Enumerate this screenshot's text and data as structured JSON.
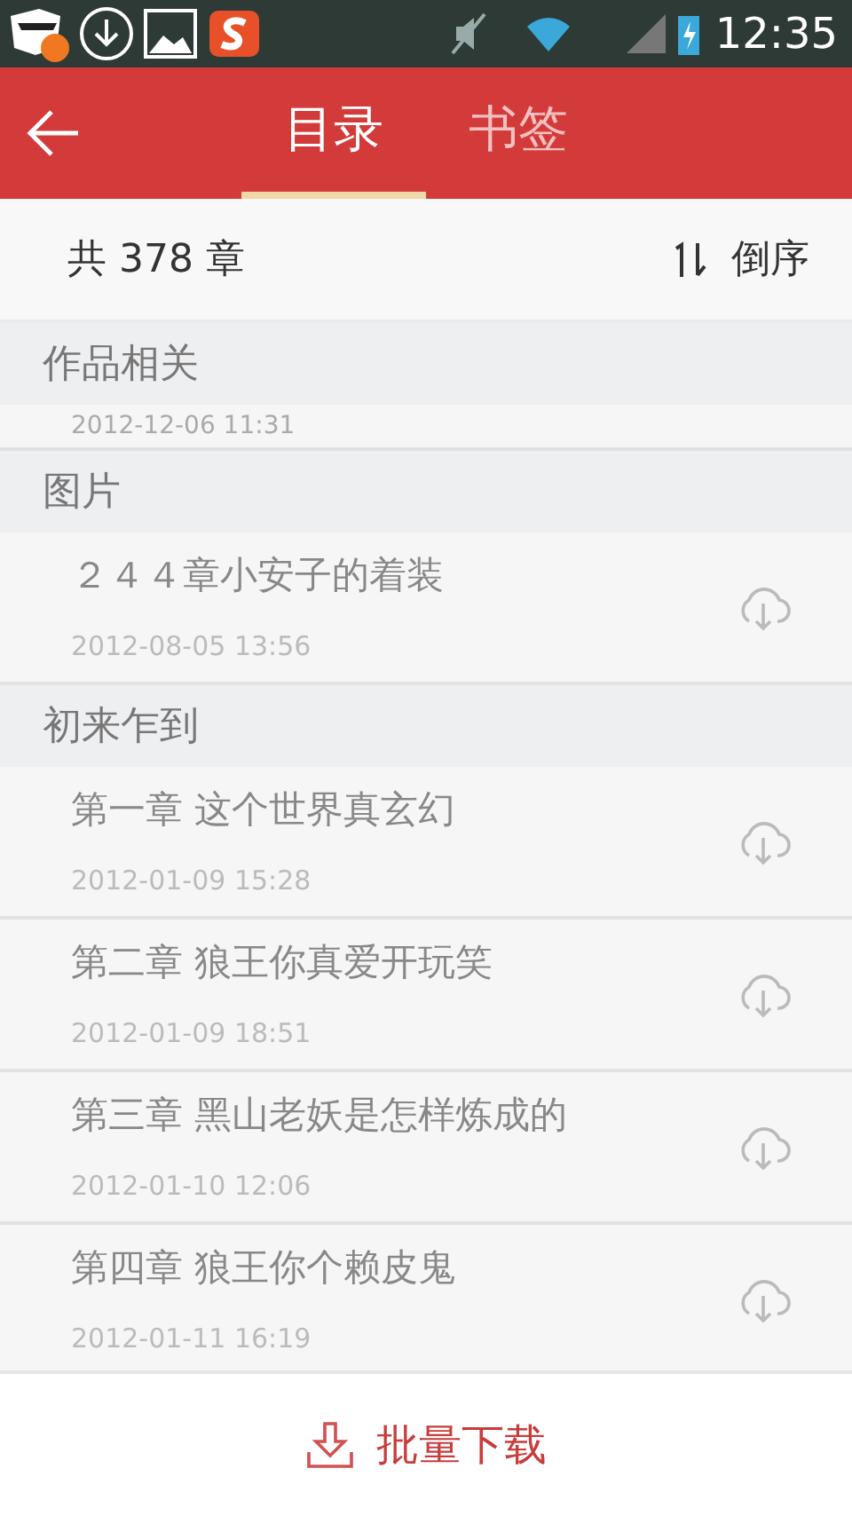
{
  "status_bar": {
    "time": "12:35"
  },
  "header": {
    "tabs": [
      {
        "label": "目录",
        "selected": true
      },
      {
        "label": "书签",
        "selected": false
      }
    ]
  },
  "summary": {
    "count": "共 378 章",
    "sort_label": "倒序"
  },
  "sections": [
    {
      "title": "作品相关",
      "items": [
        {
          "date": "2012-12-06 11:31"
        }
      ]
    },
    {
      "title": "图片",
      "items": [
        {
          "title": "２４４章小安子的着装",
          "date": "2012-08-05 13:56"
        }
      ]
    },
    {
      "title": "初来乍到",
      "items": [
        {
          "title": "第一章 这个世界真玄幻",
          "date": "2012-01-09 15:28"
        },
        {
          "title": "第二章 狼王你真爱开玩笑",
          "date": "2012-01-09 18:51"
        },
        {
          "title": "第三章 黑山老妖是怎样炼成的",
          "date": "2012-01-10 12:06"
        },
        {
          "title": "第四章 狼王你个赖皮鬼",
          "date": "2012-01-11 16:19"
        }
      ]
    }
  ],
  "bottom_button": {
    "label": "批量下载"
  }
}
